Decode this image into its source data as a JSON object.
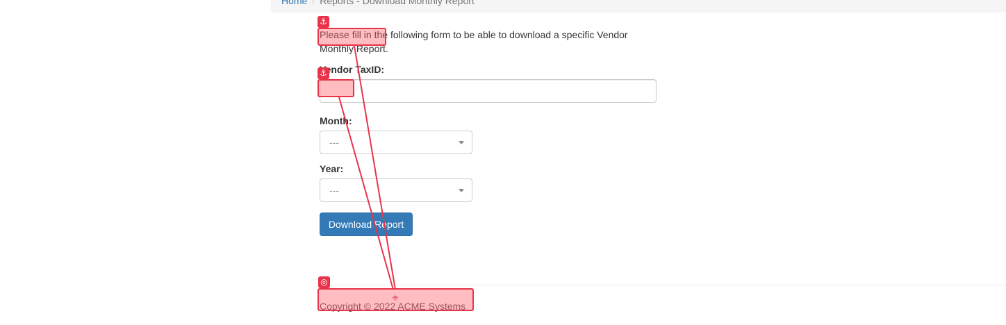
{
  "breadcrumb": {
    "home": "Home",
    "separator": "/",
    "current": "Reports - Download Monthly Report"
  },
  "form": {
    "intro": "Please fill in the following form to be able to download a specific Vendor Monthly Report.",
    "vendor_label": "Vendor TaxID:",
    "vendor_value": "",
    "month_label": "Month:",
    "month_selected": "---",
    "year_label": "Year:",
    "year_selected": "---",
    "download_button": "Download Report"
  },
  "footer": {
    "copyright": "Copyright © 2022 ACME Systems"
  },
  "overlay": {
    "anchor_glyph": "⚓",
    "target_glyph": "◎",
    "target_marker": "⌖",
    "accent_color": "#e8334a"
  },
  "colors": {
    "primary_button": "#337ab7",
    "link": "#337ab7",
    "breadcrumb_bg": "#f5f5f5"
  }
}
